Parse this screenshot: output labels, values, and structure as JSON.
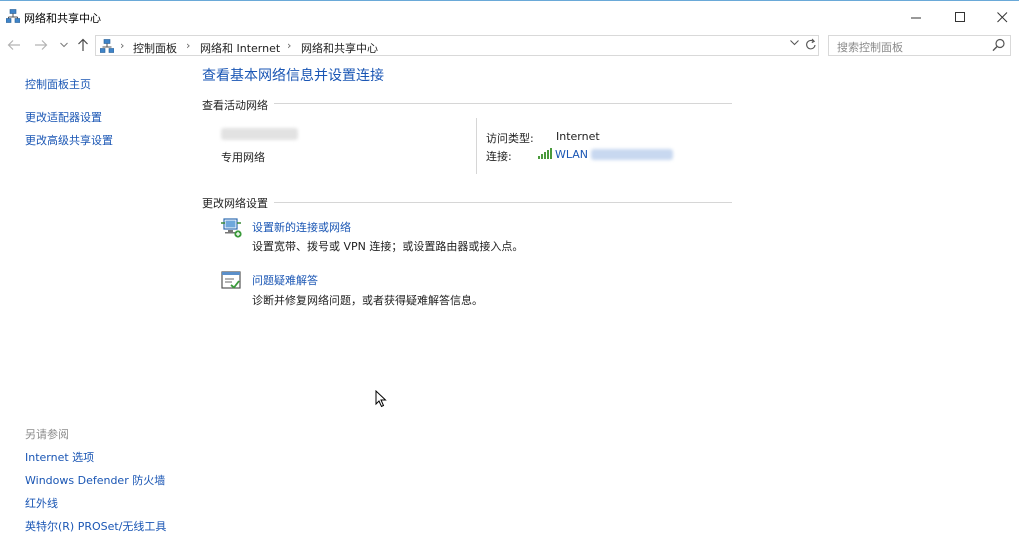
{
  "window": {
    "title": "网络和共享中心",
    "controls": {
      "minimize": "—",
      "maximize": "☐",
      "close": "✕"
    }
  },
  "navigation": {
    "back_icon": "arrow-left-icon",
    "forward_icon": "arrow-right-icon",
    "up_icon": "arrow-up-icon",
    "breadcrumbs": [
      "控制面板",
      "网络和 Internet",
      "网络和共享中心"
    ],
    "separator": "›",
    "search_placeholder": "搜索控制面板"
  },
  "sidebar": {
    "links": [
      "控制面板主页",
      "更改适配器设置",
      "更改高级共享设置"
    ],
    "see_also_label": "另请参阅",
    "see_also_links": [
      "Internet 选项",
      "Windows Defender 防火墙",
      "红外线",
      "英特尔(R) PROSet/无线工具"
    ]
  },
  "main": {
    "title": "查看基本网络信息并设置连接",
    "active_networks": {
      "section_label": "查看活动网络",
      "network_type": "专用网络",
      "access_type_label": "访问类型:",
      "access_type_value": "Internet",
      "connections_label": "连接:",
      "connection_name": "WLAN"
    },
    "change_settings": {
      "section_label": "更改网络设置",
      "tasks": [
        {
          "title": "设置新的连接或网络",
          "description": "设置宽带、拨号或 VPN 连接；或设置路由器或接入点。"
        },
        {
          "title": "问题疑难解答",
          "description": "诊断并修复网络问题，或者获得疑难解答信息。"
        }
      ]
    }
  },
  "colors": {
    "link": "#1a56b4",
    "divider": "#d6d6d6"
  }
}
